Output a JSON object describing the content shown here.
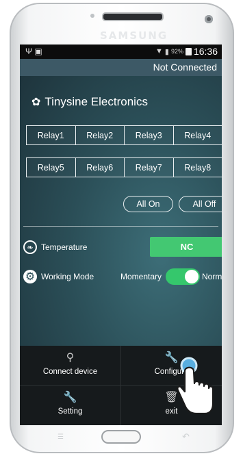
{
  "device": {
    "brand": "SAMSUNG"
  },
  "status_bar": {
    "battery": "92%",
    "time": "16:36",
    "icons": [
      "usb-icon",
      "notification-icon",
      "wifi-icon",
      "signal-icon",
      "battery-icon"
    ]
  },
  "title_bar": {
    "status": "Not Connected"
  },
  "app": {
    "name": "Tinysine Electronics",
    "logo_icon": "lotus-icon"
  },
  "relays": {
    "row1": [
      "Relay1",
      "Relay2",
      "Relay3",
      "Relay4"
    ],
    "row2": [
      "Relay5",
      "Relay6",
      "Relay7",
      "Relay8"
    ]
  },
  "actions": {
    "all_on": "All On",
    "all_off": "All Off"
  },
  "temperature": {
    "label": "Temperature",
    "value": "NC",
    "value_color": "#43c872"
  },
  "working_mode": {
    "label": "Working Mode",
    "left_option": "Momentary",
    "right_option": "Normal",
    "toggle_on": true,
    "toggle_color": "#35c76c"
  },
  "menu": {
    "items": [
      {
        "label": "Connect device",
        "icon": "search-icon"
      },
      {
        "label": "Configure",
        "icon": "wrench-icon"
      },
      {
        "label": "Setting",
        "icon": "wrench-icon"
      },
      {
        "label": "exit",
        "icon": "trash-icon"
      }
    ]
  }
}
